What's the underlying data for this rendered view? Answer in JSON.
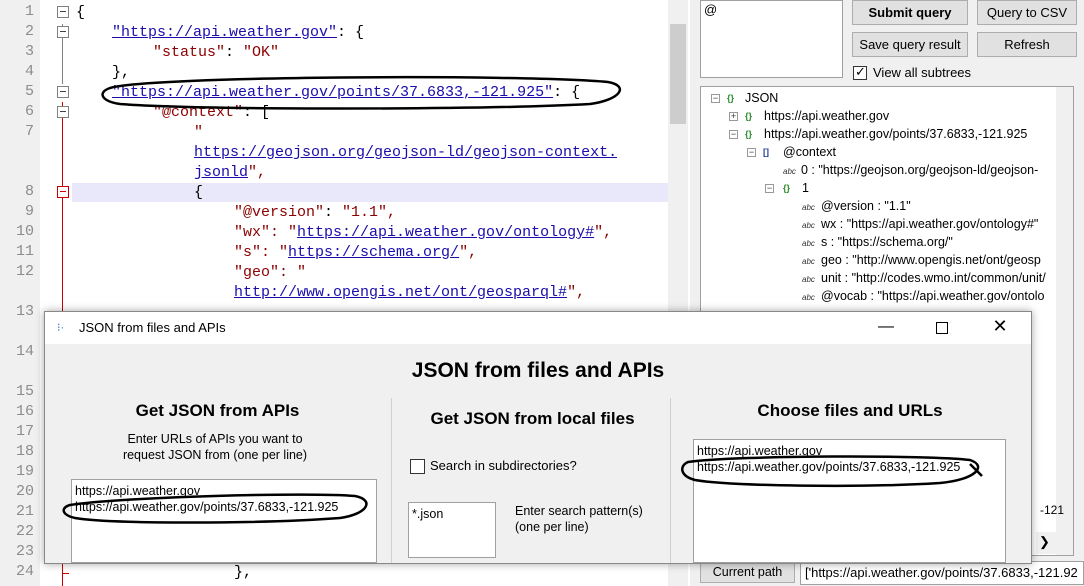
{
  "editor": {
    "line_numbers": [
      "1",
      "2",
      "3",
      "4",
      "5",
      "6",
      "7",
      "8",
      "9",
      "10",
      "11",
      "12",
      "13",
      "14",
      "15",
      "16",
      "17",
      "18",
      "19",
      "20",
      "21",
      "22",
      "23",
      "24"
    ],
    "lines": {
      "l1": "{",
      "l2_url": "\"https://api.weather.gov\"",
      "l2_rest": ": {",
      "l3_key": "\"status\"",
      "l3_sep": ": ",
      "l3_val": "\"OK\"",
      "l4": "},",
      "l5_url": "\"https://api.weather.gov/points/37.6833,-121.925\"",
      "l5_rest": ": {",
      "l6_key": "\"@context\"",
      "l6_rest": ": [",
      "l7_quote": "\"",
      "l7_url": "https://geojson.org/geojson-ld/geojson-context.",
      "l7b_url": "jsonld",
      "l7b_rest": "\",",
      "l8": "{",
      "l9_key": "\"@version\"",
      "l9_sep": ": ",
      "l9_val": "\"1.1\",",
      "l10_key": "\"wx\"",
      "l10_sep": ": \"",
      "l10_url": "https://api.weather.gov/ontology#",
      "l10_rest": "\",",
      "l11_key": "\"s\"",
      "l11_sep": ": \"",
      "l11_url": "https://schema.org/",
      "l11_rest": "\",",
      "l12_key": "\"geo\"",
      "l12_rest": ": \"",
      "l12b_url": "http://www.opengis.net/ont/geosparql#",
      "l12b_rest": "\",",
      "l24": "},"
    }
  },
  "query": {
    "value": "@",
    "submit_label": "Submit query",
    "csv_label": "Query to CSV",
    "save_label": "Save query result",
    "refresh_label": "Refresh",
    "view_subtrees_label": "View all subtrees",
    "view_subtrees_checked": true
  },
  "tree": {
    "root": "JSON",
    "n1": "https://api.weather.gov",
    "n2": "https://api.weather.gov/points/37.6833,-121.925",
    "n3": "@context",
    "n4": "0 : \"https://geojson.org/geojson-ld/geojson-",
    "n5": "1",
    "n6": "@version : \"1.1\"",
    "n7": "wx : \"https://api.weather.gov/ontology#\"",
    "n8": "s : \"https://schema.org/\"",
    "n9": "geo : \"http://www.opengis.net/ont/geosp",
    "n10": "unit : \"http://codes.wmo.int/common/unit/",
    "n11": "@vocab : \"https://api.weather.gov/ontolo",
    "stub": "-121",
    "icon_object": "{}",
    "icon_array": "[]",
    "icon_value": "abc"
  },
  "path": {
    "button_label": "Current path",
    "value": "['https://api.weather.gov/points/37.6833,-121.92"
  },
  "dialog": {
    "title": "JSON from files and APIs",
    "heading": "JSON from files and APIs",
    "api": {
      "title": "Get JSON from APIs",
      "description": "Enter URLs of APIs you want to request JSON from (one per line)",
      "line1": "https://api.weather.gov",
      "line2": "https://api.weather.gov/points/37.6833,-121.925"
    },
    "local": {
      "title": "Get JSON from local files",
      "subdir_label": "Search in subdirectories?",
      "subdir_checked": false,
      "pattern": "*.json",
      "pattern_desc": "Enter search pattern(s) (one per line)"
    },
    "choose": {
      "title": "Choose files and URLs",
      "line1": "https://api.weather.gov",
      "line2": "https://api.weather.gov/points/37.6833,-121.925"
    }
  }
}
